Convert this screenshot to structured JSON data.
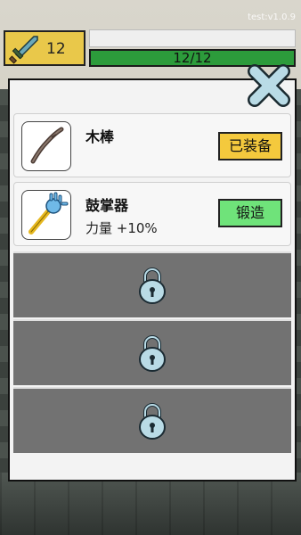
{
  "version": "test:v1.0.9",
  "player": {
    "level": "12"
  },
  "hp": {
    "text": "12/12",
    "fraction": 1.0
  },
  "panel": {
    "slots": [
      {
        "name": "木棒",
        "stat": "",
        "button": "已装备",
        "state": "equipped",
        "icon": "wooden-stick-icon"
      },
      {
        "name": "鼓掌器",
        "stat": "力量 +10%",
        "button": "锻造",
        "state": "forge",
        "icon": "clapper-hand-icon"
      }
    ],
    "locked_slots": 3
  },
  "colors": {
    "equipped_button": "#f4c93d",
    "forge_button": "#6fe37a",
    "hp_bar": "#2c9b3b",
    "level_badge": "#e9c84a",
    "lock_icon": "#b9dbe6"
  }
}
